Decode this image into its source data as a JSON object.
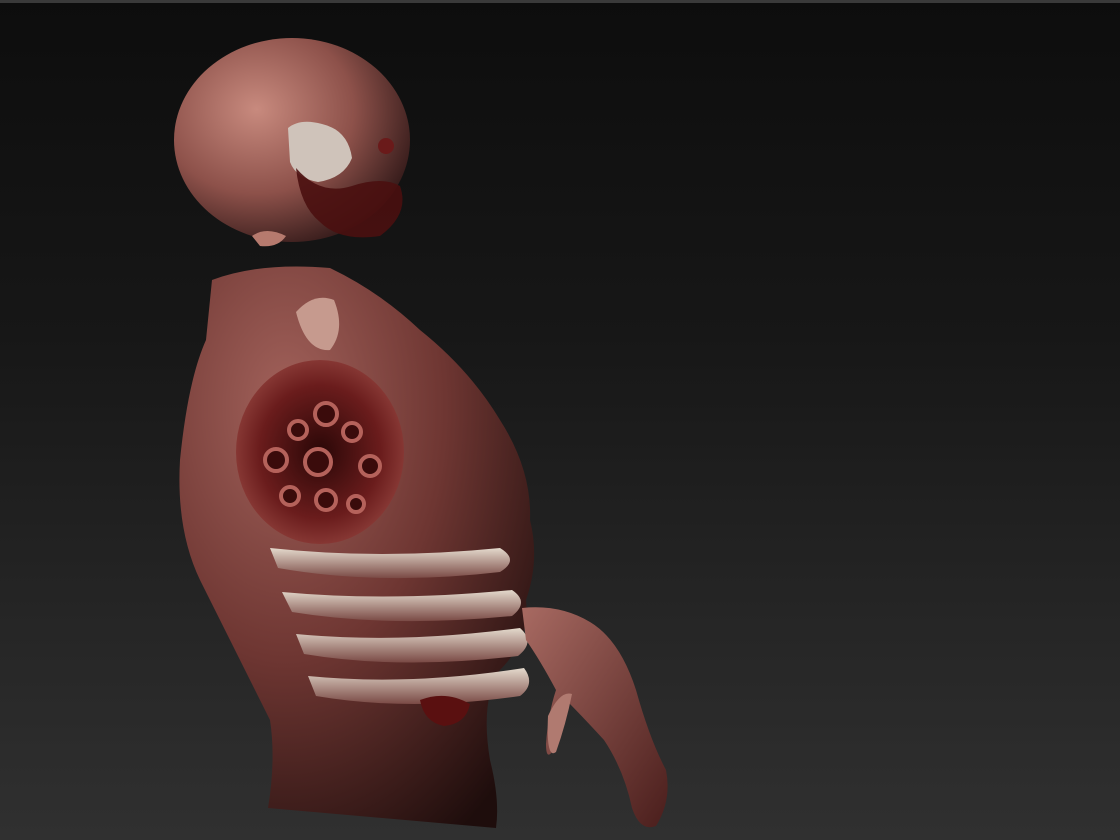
{
  "app": {
    "view": "3d-sculpt-viewport"
  },
  "viewport": {
    "background_top": "#0d0d0d",
    "background_bottom": "#303030",
    "model": {
      "subject": "flesh-creature-bust",
      "skin_color": "#9a5a55",
      "wound_color": "#5a1414",
      "bone_color": "#d8cfc2"
    }
  }
}
